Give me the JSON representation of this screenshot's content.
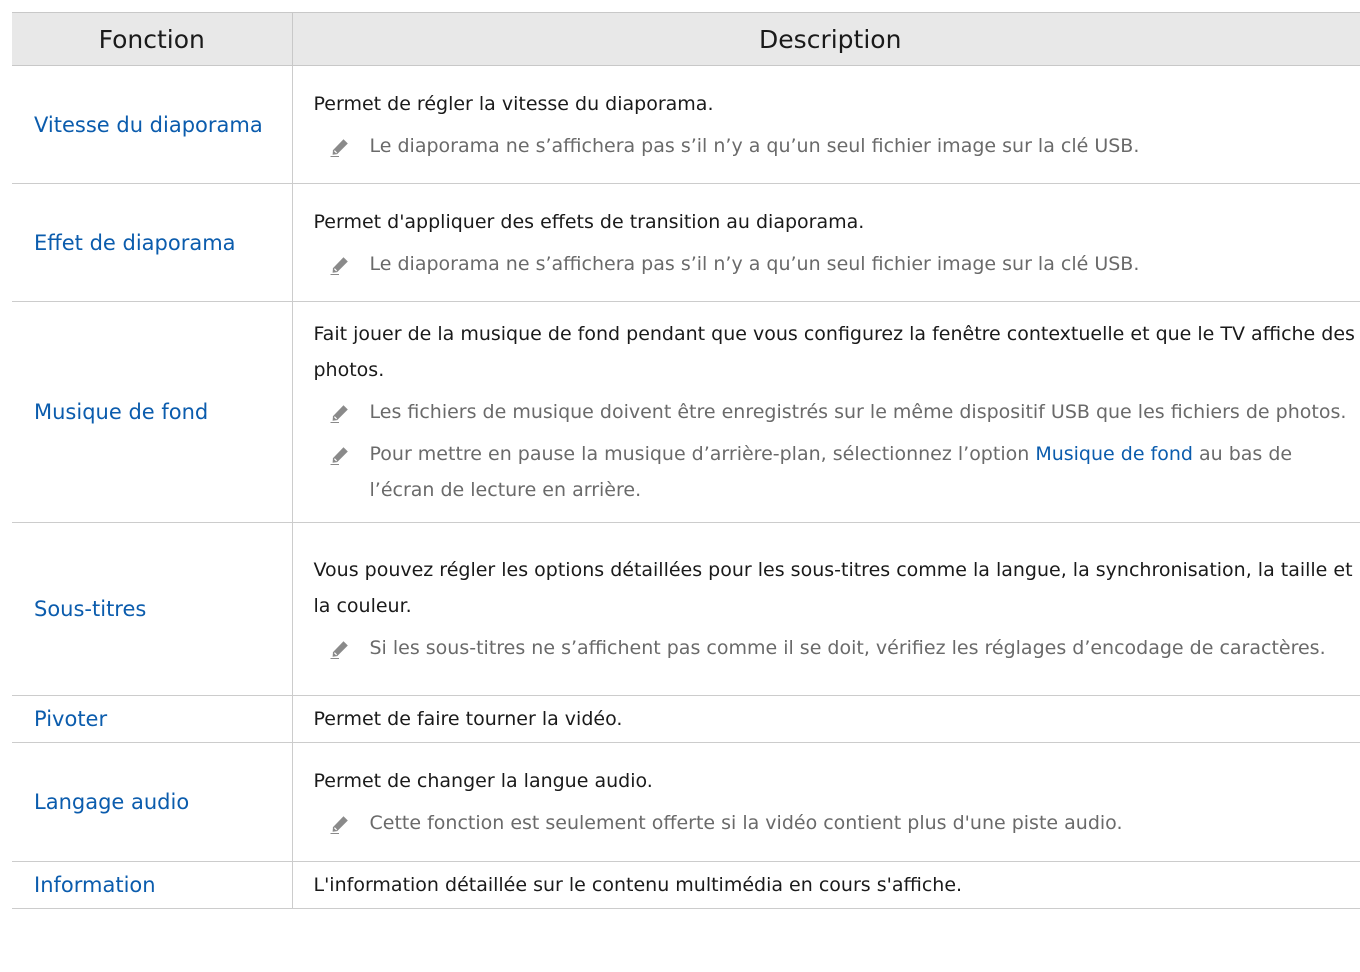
{
  "table": {
    "header": {
      "col1": "Fonction",
      "col2": "Description"
    },
    "rows": [
      {
        "name": "Vitesse du diaporama",
        "desc": "Permet de régler la vitesse du diaporama.",
        "notes": [
          "Le diaporama ne s’affichera pas s’il n’y a qu’un seul fichier image sur la clé USB."
        ]
      },
      {
        "name": "Effet de diaporama",
        "desc": "Permet d'appliquer des effets de transition au diaporama.",
        "notes": [
          "Le diaporama ne s’affichera pas s’il n’y a qu’un seul fichier image sur la clé USB."
        ]
      },
      {
        "name": "Musique de fond",
        "desc": "Fait jouer de la musique de fond pendant que vous configurez la fenêtre contextuelle et que le TV affiche des photos.",
        "notes": [
          "Les fichiers de musique doivent être enregistrés sur le même dispositif USB que les fichiers de photos.",
          "Pour mettre en pause la musique d’arrière-plan, sélectionnez l’option "
        ],
        "note2_link": "Musique de fond",
        "note2_suffix": " au bas de l’écran de lecture en arrière."
      },
      {
        "name": "Sous-titres",
        "desc": "Vous pouvez régler les options détaillées pour les sous-titres comme la langue, la synchronisation, la taille et la couleur.",
        "notes": [
          "Si les sous-titres ne s’affichent pas comme il se doit, vérifiez les réglages d’encodage de caractères."
        ]
      },
      {
        "name": "Pivoter",
        "desc": "Permet de faire tourner la vidéo."
      },
      {
        "name": "Langage audio",
        "desc": "Permet de changer la langue audio.",
        "notes": [
          "Cette fonction est seulement offerte si la vidéo contient plus d'une piste audio."
        ]
      },
      {
        "name": "Information",
        "desc": "L'information détaillée sur le contenu multimédia en cours s'affiche."
      }
    ]
  },
  "colors": {
    "function_link": "#0b5cad",
    "header_bg": "#e8e8e8",
    "note_text": "#6a6a6a",
    "icon": "#8a8a8a"
  },
  "icons": {
    "note": "pencil-icon"
  }
}
